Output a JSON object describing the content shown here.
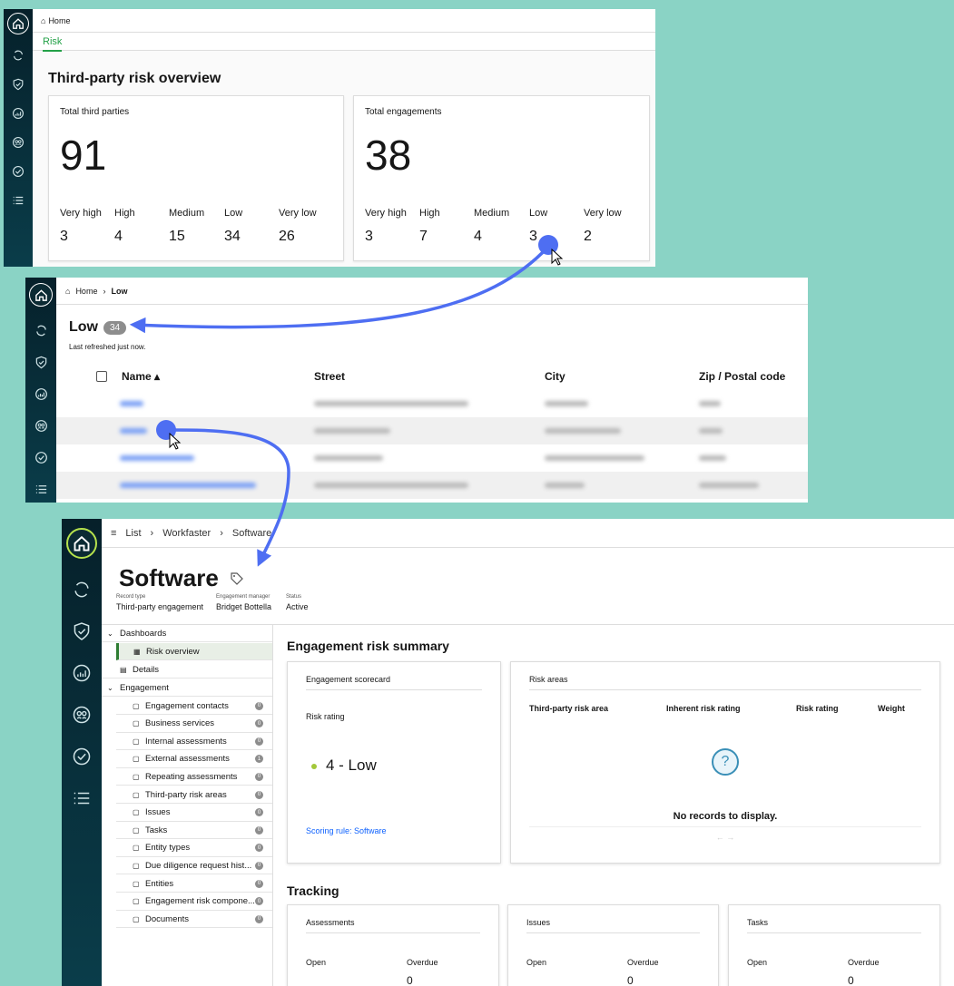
{
  "panel1": {
    "breadcrumb_home": "Home",
    "tab": "Risk",
    "heading": "Third-party risk overview",
    "cards": [
      {
        "label": "Total third parties",
        "total": "91",
        "levels": [
          {
            "name": "Very high",
            "value": "3"
          },
          {
            "name": "High",
            "value": "4"
          },
          {
            "name": "Medium",
            "value": "15"
          },
          {
            "name": "Low",
            "value": "34"
          },
          {
            "name": "Very low",
            "value": "26"
          }
        ]
      },
      {
        "label": "Total engagements",
        "total": "38",
        "levels": [
          {
            "name": "Very high",
            "value": "3"
          },
          {
            "name": "High",
            "value": "7"
          },
          {
            "name": "Medium",
            "value": "4"
          },
          {
            "name": "Low",
            "value": "3"
          },
          {
            "name": "Very low",
            "value": "2"
          }
        ]
      }
    ]
  },
  "panel2": {
    "breadcrumb_home": "Home",
    "breadcrumb_current": "Low",
    "title": "Low",
    "count": "34",
    "refreshed": "Last refreshed just now.",
    "columns": {
      "name": "Name ▴",
      "street": "Street",
      "city": "City",
      "zip": "Zip / Postal code"
    }
  },
  "panel3": {
    "breadcrumb": [
      "List",
      "Workfaster",
      "Software"
    ],
    "title": "Software",
    "meta": [
      {
        "key": "Record type",
        "value": "Third-party engagement"
      },
      {
        "key": "Engagement manager",
        "value": "Bridget Bottella"
      },
      {
        "key": "Status",
        "value": "Active"
      }
    ],
    "nav": {
      "dashboards": "Dashboards",
      "risk_overview": "Risk overview",
      "details": "Details",
      "engagement": "Engagement",
      "items": [
        {
          "label": "Engagement contacts",
          "count": "0"
        },
        {
          "label": "Business services",
          "count": "0"
        },
        {
          "label": "Internal assessments",
          "count": "0"
        },
        {
          "label": "External assessments",
          "count": "1"
        },
        {
          "label": "Repeating assessments",
          "count": "0"
        },
        {
          "label": "Third-party risk areas",
          "count": "0"
        },
        {
          "label": "Issues",
          "count": "0"
        },
        {
          "label": "Tasks",
          "count": "0"
        },
        {
          "label": "Entity types",
          "count": "0"
        },
        {
          "label": "Due diligence request hist...",
          "count": "0"
        },
        {
          "label": "Entities",
          "count": "0"
        },
        {
          "label": "Engagement risk compone...",
          "count": "0"
        },
        {
          "label": "Documents",
          "count": "0"
        }
      ]
    },
    "summary_heading": "Engagement risk summary",
    "scorecard": {
      "title": "Engagement scorecard",
      "label": "Risk rating",
      "value": "4 - Low",
      "rule": "Scoring rule: Software",
      "dot_color": "#a3c83a"
    },
    "risk_areas": {
      "title": "Risk areas",
      "columns": [
        "Third-party risk area",
        "Inherent risk rating",
        "Risk rating",
        "Weight"
      ],
      "empty": "No records to display.",
      "pager": "←   →"
    },
    "tracking_heading": "Tracking",
    "tracking": [
      {
        "title": "Assessments",
        "open": "Open",
        "overdue": "Overdue",
        "overdue_value": "0"
      },
      {
        "title": "Issues",
        "open": "Open",
        "overdue": "Overdue",
        "overdue_value": "0"
      },
      {
        "title": "Tasks",
        "open": "Open",
        "overdue": "Overdue",
        "overdue_value": "0"
      }
    ]
  },
  "colors": {
    "accent_green": "#24a148",
    "cursor_blue": "#4e6ef2",
    "link_blue": "#0f62fe"
  }
}
